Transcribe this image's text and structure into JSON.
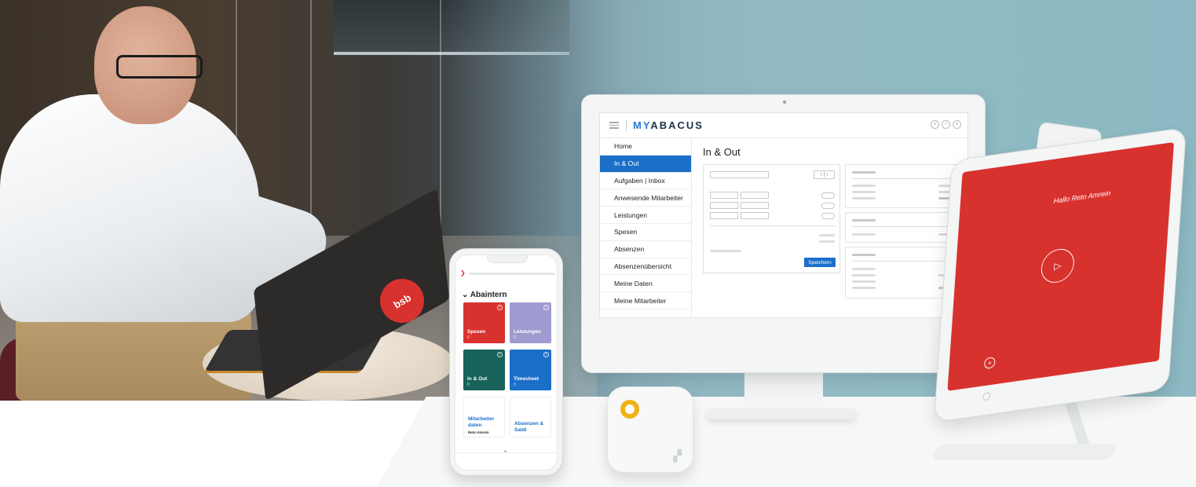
{
  "monitor_app": {
    "brand_prefix": "MY",
    "brand_name": "ABACUS",
    "nav_items": [
      "Home",
      "In & Out",
      "Aufgaben | Inbox",
      "Anwesende Mitarbeiter",
      "Leistungen",
      "Spesen",
      "Absenzen",
      "Absenzenübersicht",
      "Meine Daten",
      "Meine Mitarbeiter"
    ],
    "active_nav": "In & Out",
    "page_title": "In & Out",
    "save_button": "Speichern"
  },
  "phone_app": {
    "section_title": "Abaintern",
    "tiles": [
      {
        "label": "Spesen",
        "count": "0",
        "color": "#d8322e"
      },
      {
        "label": "Leistungen",
        "count": "0",
        "color": "#9f9bd0"
      },
      {
        "label": "In & Out",
        "count": "0",
        "color": "#176259"
      },
      {
        "label": "Timesheet",
        "count": "0",
        "color": "#1a6fc9"
      },
      {
        "label": "Mitarbeiter daten",
        "sub": "Reto Amrein"
      },
      {
        "label": "Absenzen & Saldi"
      }
    ]
  },
  "tablet_app": {
    "greeting": "Hallo Reto Amrein"
  },
  "photo": {
    "laptop_sticker": "bsb"
  },
  "colors": {
    "accent_blue": "#1a6fc9",
    "brand_red": "#d8322e",
    "teal_bg": "#8cb9c3",
    "terminal_yellow": "#f1b216"
  },
  "icons": {
    "menu": "hamburger-icon",
    "window_controls": [
      "maximize-icon",
      "minimize-icon",
      "close-icon"
    ],
    "tablet_play": "play-icon",
    "tablet_add": "plus-icon"
  }
}
